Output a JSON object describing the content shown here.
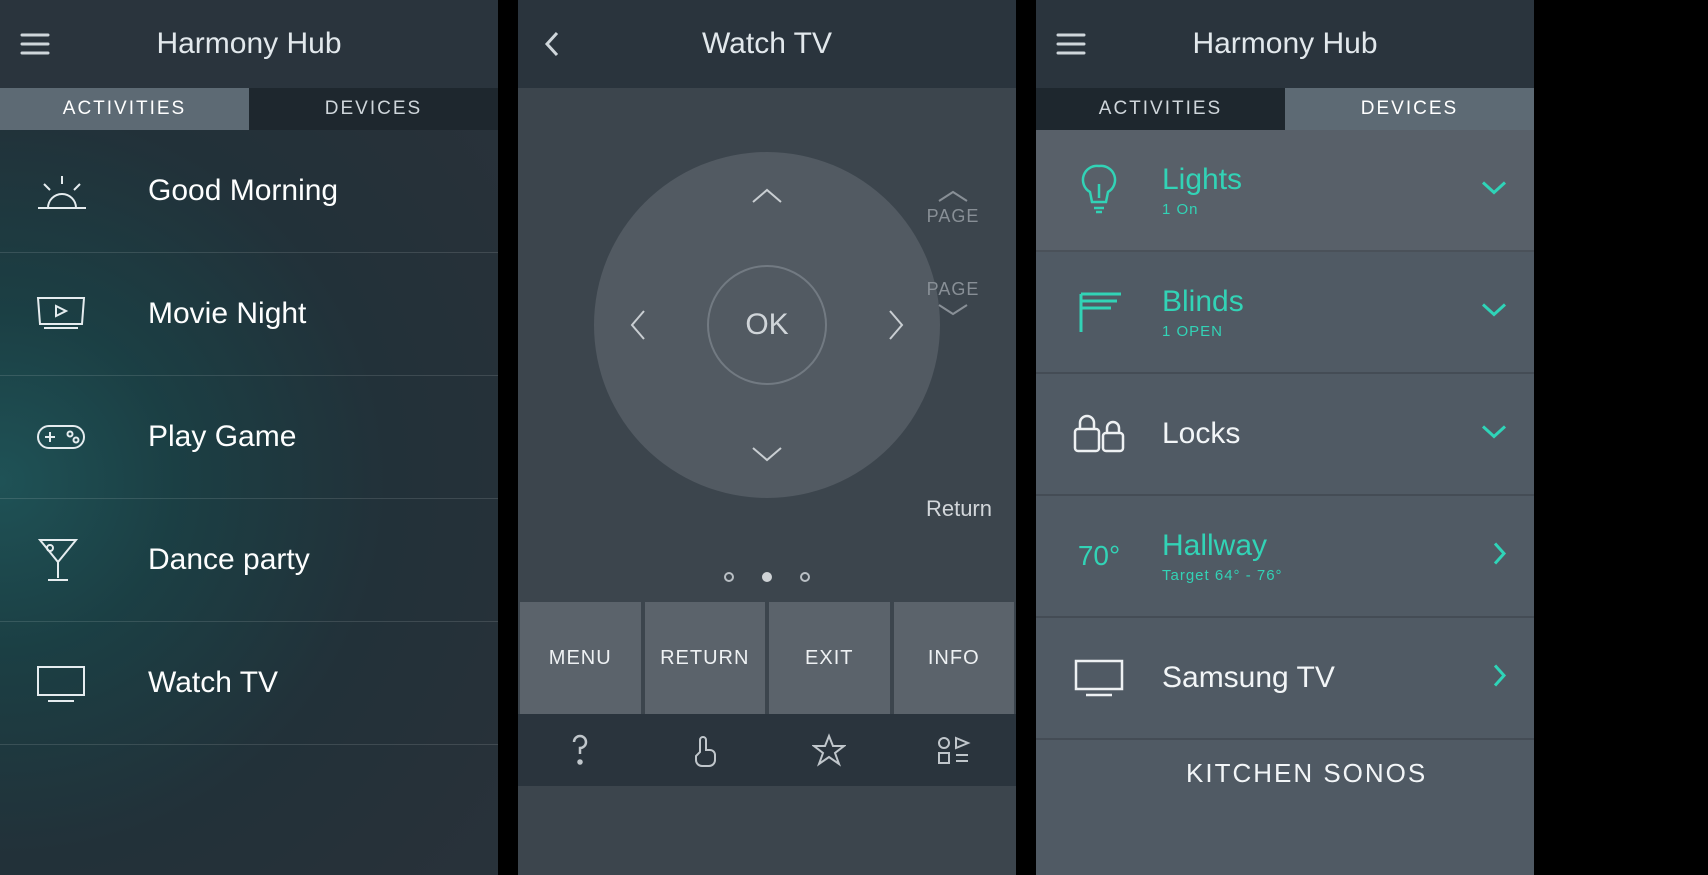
{
  "screen1": {
    "header_title": "Harmony Hub",
    "tabs": {
      "activities": "ACTIVITIES",
      "devices": "DEVICES",
      "active": "activities"
    },
    "activities": [
      {
        "icon": "sunrise",
        "label": "Good Morning"
      },
      {
        "icon": "movie",
        "label": "Movie Night"
      },
      {
        "icon": "gamepad",
        "label": "Play Game"
      },
      {
        "icon": "cocktail",
        "label": "Dance party"
      },
      {
        "icon": "tv",
        "label": "Watch TV"
      }
    ]
  },
  "screen2": {
    "header_title": "Watch TV",
    "ok_label": "OK",
    "page_label": "PAGE",
    "return_label": "Return",
    "page_dots": {
      "count": 3,
      "active_index": 1
    },
    "soft_buttons": [
      "MENU",
      "RETURN",
      "EXIT",
      "INFO"
    ],
    "bottom_icons": [
      "help",
      "gesture",
      "favorite",
      "activity"
    ]
  },
  "screen3": {
    "header_title": "Harmony Hub",
    "tabs": {
      "activities": "ACTIVITIES",
      "devices": "DEVICES",
      "active": "devices"
    },
    "devices": [
      {
        "icon": "light",
        "title": "Lights",
        "sub": "1  On",
        "accent": "teal",
        "expand": "down"
      },
      {
        "icon": "blinds",
        "title": "Blinds",
        "sub": "1 OPEN",
        "accent": "teal",
        "expand": "down"
      },
      {
        "icon": "lock",
        "title": "Locks",
        "sub": "",
        "accent": "white",
        "expand": "down"
      },
      {
        "icon": "thermo",
        "title": "Hallway",
        "sub": "Target  64° - 76°",
        "accent": "teal",
        "expand": "right",
        "temp": "70°"
      },
      {
        "icon": "tv",
        "title": "Samsung TV",
        "sub": "",
        "accent": "white",
        "expand": "right"
      }
    ],
    "partial_row_label": "KITCHEN SONOS"
  }
}
